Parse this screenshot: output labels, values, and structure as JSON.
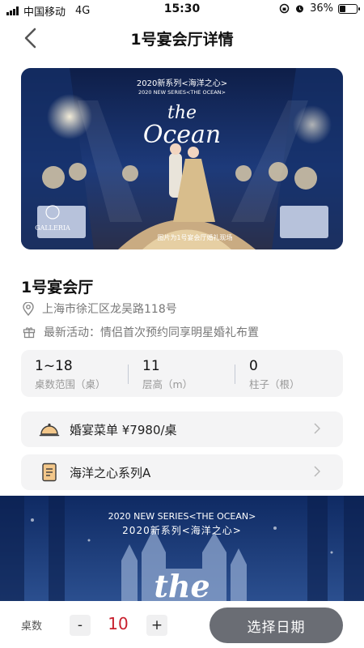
{
  "status_bar": {
    "carrier": "中国移动",
    "network": "4G",
    "time": "15:30",
    "battery_percent": "36%",
    "battery_level": 0.36
  },
  "nav": {
    "title": "1号宴会厅详情",
    "back_icon": "chevron-left-icon"
  },
  "hero": {
    "series_cn": "2020新系列<海洋之心>",
    "series_en": "2020 NEW SERIES<THE OCEAN>",
    "script_line1": "the",
    "script_line2": "Ocean",
    "brand": "GALLERIA",
    "caption": "图片为1号宴会厅婚礼现场"
  },
  "hall": {
    "name": "1号宴会厅",
    "address": "上海市徐汇区龙吴路118号",
    "promo": "最新活动：情侣首次预约同享明星婚礼布置"
  },
  "stats": [
    {
      "value": "1~18",
      "label": "桌数范围（桌）"
    },
    {
      "value": "11",
      "label": "层高（m）"
    },
    {
      "value": "0",
      "label": "柱子（根）"
    }
  ],
  "cards": {
    "menu_label": "婚宴菜单 ¥7980/桌",
    "series_label": "海洋之心系列A"
  },
  "banner2": {
    "series_en": "2020 NEW SERIES<THE OCEAN>",
    "series_cn": "2020新系列<海洋之心>",
    "script": "the"
  },
  "bottom": {
    "qty_label": "桌数",
    "minus": "-",
    "plus": "+",
    "qty_value": "10",
    "date_button": "选择日期"
  },
  "colors": {
    "accent_red": "#c8202e",
    "button_gray": "#6a6d74",
    "card_bg": "#f4f4f5",
    "ocean_blue": "#1b3c7a"
  }
}
